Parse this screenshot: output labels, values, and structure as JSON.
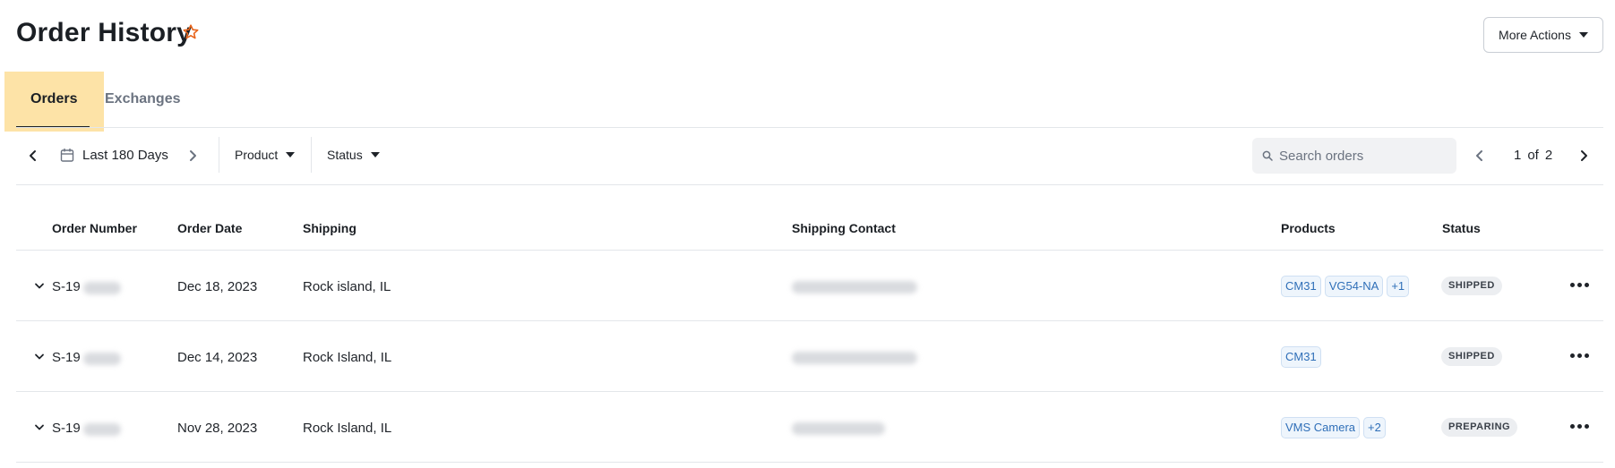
{
  "header": {
    "title": "Order History",
    "more_actions_label": "More Actions"
  },
  "tabs": [
    {
      "label": "Orders",
      "active": true
    },
    {
      "label": "Exchanges",
      "active": false
    }
  ],
  "toolbar": {
    "date_range": "Last 180 Days",
    "filters": {
      "product": "Product",
      "status": "Status"
    },
    "search_placeholder": "Search orders",
    "pagination": {
      "current": "1",
      "of": "of",
      "total": "2"
    }
  },
  "table": {
    "columns": [
      "Order Number",
      "Order Date",
      "Shipping",
      "Shipping Contact",
      "Products",
      "Status"
    ],
    "rows": [
      {
        "order_number": "S-19",
        "date": "Dec 18, 2023",
        "shipping": "Rock island, IL",
        "products": [
          "CM31",
          "VG54-NA"
        ],
        "more": "+1",
        "status": "SHIPPED"
      },
      {
        "order_number": "S-19",
        "date": "Dec 14, 2023",
        "shipping": "Rock Island, IL",
        "products": [
          "CM31"
        ],
        "more": "",
        "status": "SHIPPED"
      },
      {
        "order_number": "S-19",
        "date": "Nov 28, 2023",
        "shipping": "Rock Island, IL",
        "products": [
          "VMS Camera"
        ],
        "more": "+2",
        "status": "PREPARING"
      }
    ]
  },
  "colors": {
    "accent": "#e8641b",
    "tab_highlight": "#fde3a7",
    "chip_text": "#2f6fb8"
  }
}
